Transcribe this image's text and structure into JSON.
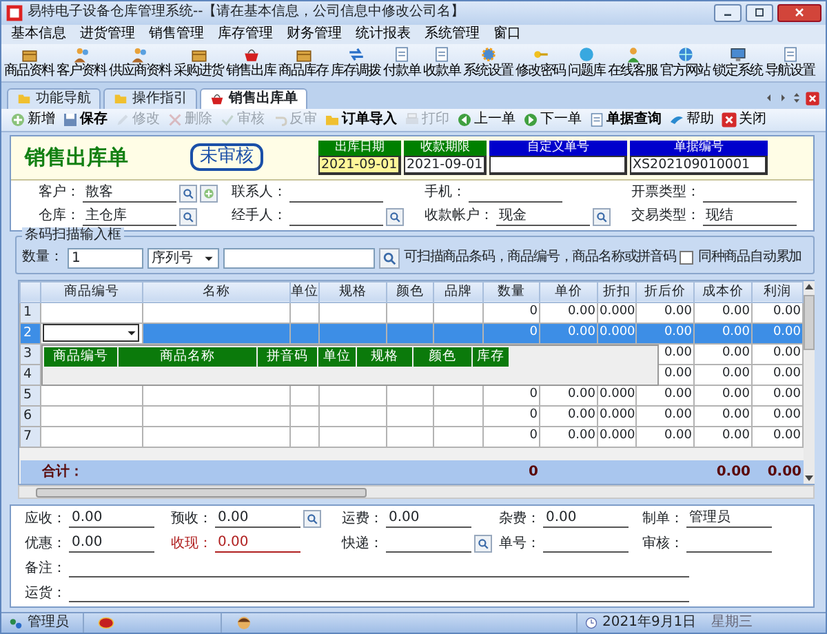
{
  "window": {
    "title": "易特电子设备仓库管理系统--【请在基本信息，公司信息中修改公司名】"
  },
  "menu": [
    "基本信息",
    "进货管理",
    "销售管理",
    "库存管理",
    "财务管理",
    "统计报表",
    "系统管理",
    "窗口"
  ],
  "toolbar": [
    "商品资料",
    "客户资料",
    "供应商资料",
    "采购进货",
    "销售出库",
    "商品库存",
    "库存调拨",
    "付款单",
    "收款单",
    "系统设置",
    "修改密码",
    "问题库",
    "在线客服",
    "官方网站",
    "锁定系统",
    "导航设置"
  ],
  "tabs": [
    {
      "label": "功能导航",
      "selected": false
    },
    {
      "label": "操作指引",
      "selected": false
    },
    {
      "label": "销售出库单",
      "selected": true
    }
  ],
  "actions": [
    {
      "label": "新增",
      "disabled": false
    },
    {
      "label": "保存",
      "disabled": false
    },
    {
      "label": "修改",
      "disabled": true
    },
    {
      "label": "删除",
      "disabled": true
    },
    {
      "label": "审核",
      "disabled": true
    },
    {
      "label": "反审",
      "disabled": true
    },
    {
      "label": "订单导入",
      "disabled": false
    },
    {
      "label": "打印",
      "disabled": true
    },
    {
      "label": "上一单",
      "disabled": false
    },
    {
      "label": "下一单",
      "disabled": false
    },
    {
      "label": "单据查询",
      "disabled": false
    },
    {
      "label": "帮助",
      "disabled": false
    },
    {
      "label": "关闭",
      "disabled": false
    }
  ],
  "header": {
    "title": "销售出库单",
    "status": "未审核",
    "fields": [
      {
        "label": "出库日期",
        "value": "2021-09-01",
        "color": "#008000",
        "focused": true
      },
      {
        "label": "收款期限",
        "value": "2021-09-01",
        "color": "#008000",
        "focused": false
      },
      {
        "label": "自定义单号",
        "color": "#0000cc",
        "focused": false
      },
      {
        "label": "单据编号",
        "value": "XS202109010001",
        "color": "#0000cc",
        "focused": false
      }
    ]
  },
  "form": [
    [
      {
        "label": "客户：",
        "value": "散客",
        "kind": "lookup_add"
      },
      {
        "label": "联系人：",
        "kind": "plain"
      },
      {
        "label": "手机：",
        "kind": "plain"
      },
      {
        "label": "开票类型：",
        "kind": "plain"
      }
    ],
    [
      {
        "label": "仓库：",
        "value": "主仓库",
        "kind": "lookup"
      },
      {
        "label": "经手人：",
        "kind": "lookup"
      },
      {
        "label": "收款帐户：",
        "value": "现金",
        "kind": "lookup"
      },
      {
        "label": "交易类型：",
        "value": "现结",
        "kind": "plain"
      }
    ]
  ],
  "scan": {
    "title": "条码扫描输入框",
    "quantity_label": "数量：",
    "quantity": "1",
    "mode": "序列号",
    "hint": "可扫描商品条码，商品编号，商品名称或拼音码",
    "auto_merge": {
      "label": "同种商品自动累加",
      "checked": false
    }
  },
  "grid": {
    "columns": [
      "商品编号",
      "名称",
      "单位",
      "规格",
      "颜色",
      "品牌",
      "数量",
      "单价",
      "折扣",
      "折后价",
      "成本价",
      "利润"
    ],
    "rows": [
      {
        "number": "1",
        "selected": false,
        "quantity": "0",
        "unit_price": "0.00",
        "discount": "0.000",
        "discounted_price": "0.00",
        "cost_price": "0.00",
        "profit": "0.00"
      },
      {
        "number": "2",
        "selected": true,
        "quantity": "0",
        "unit_price": "0.00",
        "discount": "0.000",
        "discounted_price": "0.00",
        "cost_price": "0.00",
        "profit": "0.00"
      },
      {
        "number": "3",
        "selected": false,
        "discounted_price": "0.00",
        "cost_price": "0.00",
        "profit": "0.00"
      },
      {
        "number": "4",
        "selected": false,
        "discounted_price": "0.00",
        "cost_price": "0.00",
        "profit": "0.00"
      },
      {
        "number": "5",
        "selected": false,
        "quantity": "0",
        "unit_price": "0.00",
        "discount": "0.000",
        "discounted_price": "0.00",
        "cost_price": "0.00",
        "profit": "0.00"
      },
      {
        "number": "6",
        "selected": false,
        "quantity": "0",
        "unit_price": "0.00",
        "discount": "0.000",
        "discounted_price": "0.00",
        "cost_price": "0.00",
        "profit": "0.00"
      },
      {
        "number": "7",
        "selected": false,
        "quantity": "0",
        "unit_price": "0.00",
        "discount": "0.000",
        "discounted_price": "0.00",
        "cost_price": "0.00",
        "profit": "0.00"
      }
    ],
    "dropdown": {
      "columns": [
        "商品编号",
        "商品名称",
        "拼音码",
        "单位",
        "规格",
        "颜色",
        "库存"
      ]
    },
    "total": {
      "label": "合计：",
      "quantity": "0",
      "cost_price": "0.00",
      "profit": "0.00"
    }
  },
  "footer": [
    [
      {
        "label": "应收：",
        "value": "0.00",
        "kind": "plain",
        "highlighted": false
      },
      {
        "label": "预收：",
        "value": "0.00",
        "kind": "lookup",
        "highlighted": false
      },
      {
        "label": "运费：",
        "value": "0.00",
        "kind": "plain",
        "highlighted": false
      },
      {
        "label": "杂费：",
        "value": "0.00",
        "kind": "plain",
        "highlighted": false
      },
      {
        "label": "制单：",
        "value": "管理员",
        "kind": "plain",
        "highlighted": false
      }
    ],
    [
      {
        "label": "优惠：",
        "value": "0.00",
        "kind": "plain",
        "highlighted": false
      },
      {
        "label": "收现：",
        "value": "0.00",
        "kind": "plain",
        "highlighted": true
      },
      {
        "label": "快递：",
        "kind": "lookup",
        "highlighted": false
      },
      {
        "label": "单号：",
        "kind": "plain",
        "highlighted": false
      },
      {
        "label": "审核：",
        "kind": "plain",
        "highlighted": false
      }
    ],
    [
      {
        "label": "备注：",
        "kind": "wide"
      }
    ],
    [
      {
        "label": "运货：",
        "kind": "wide"
      }
    ]
  ],
  "status_bar": {
    "user": "管理员",
    "date": "2021年9月1日",
    "weekday": "星期三"
  }
}
